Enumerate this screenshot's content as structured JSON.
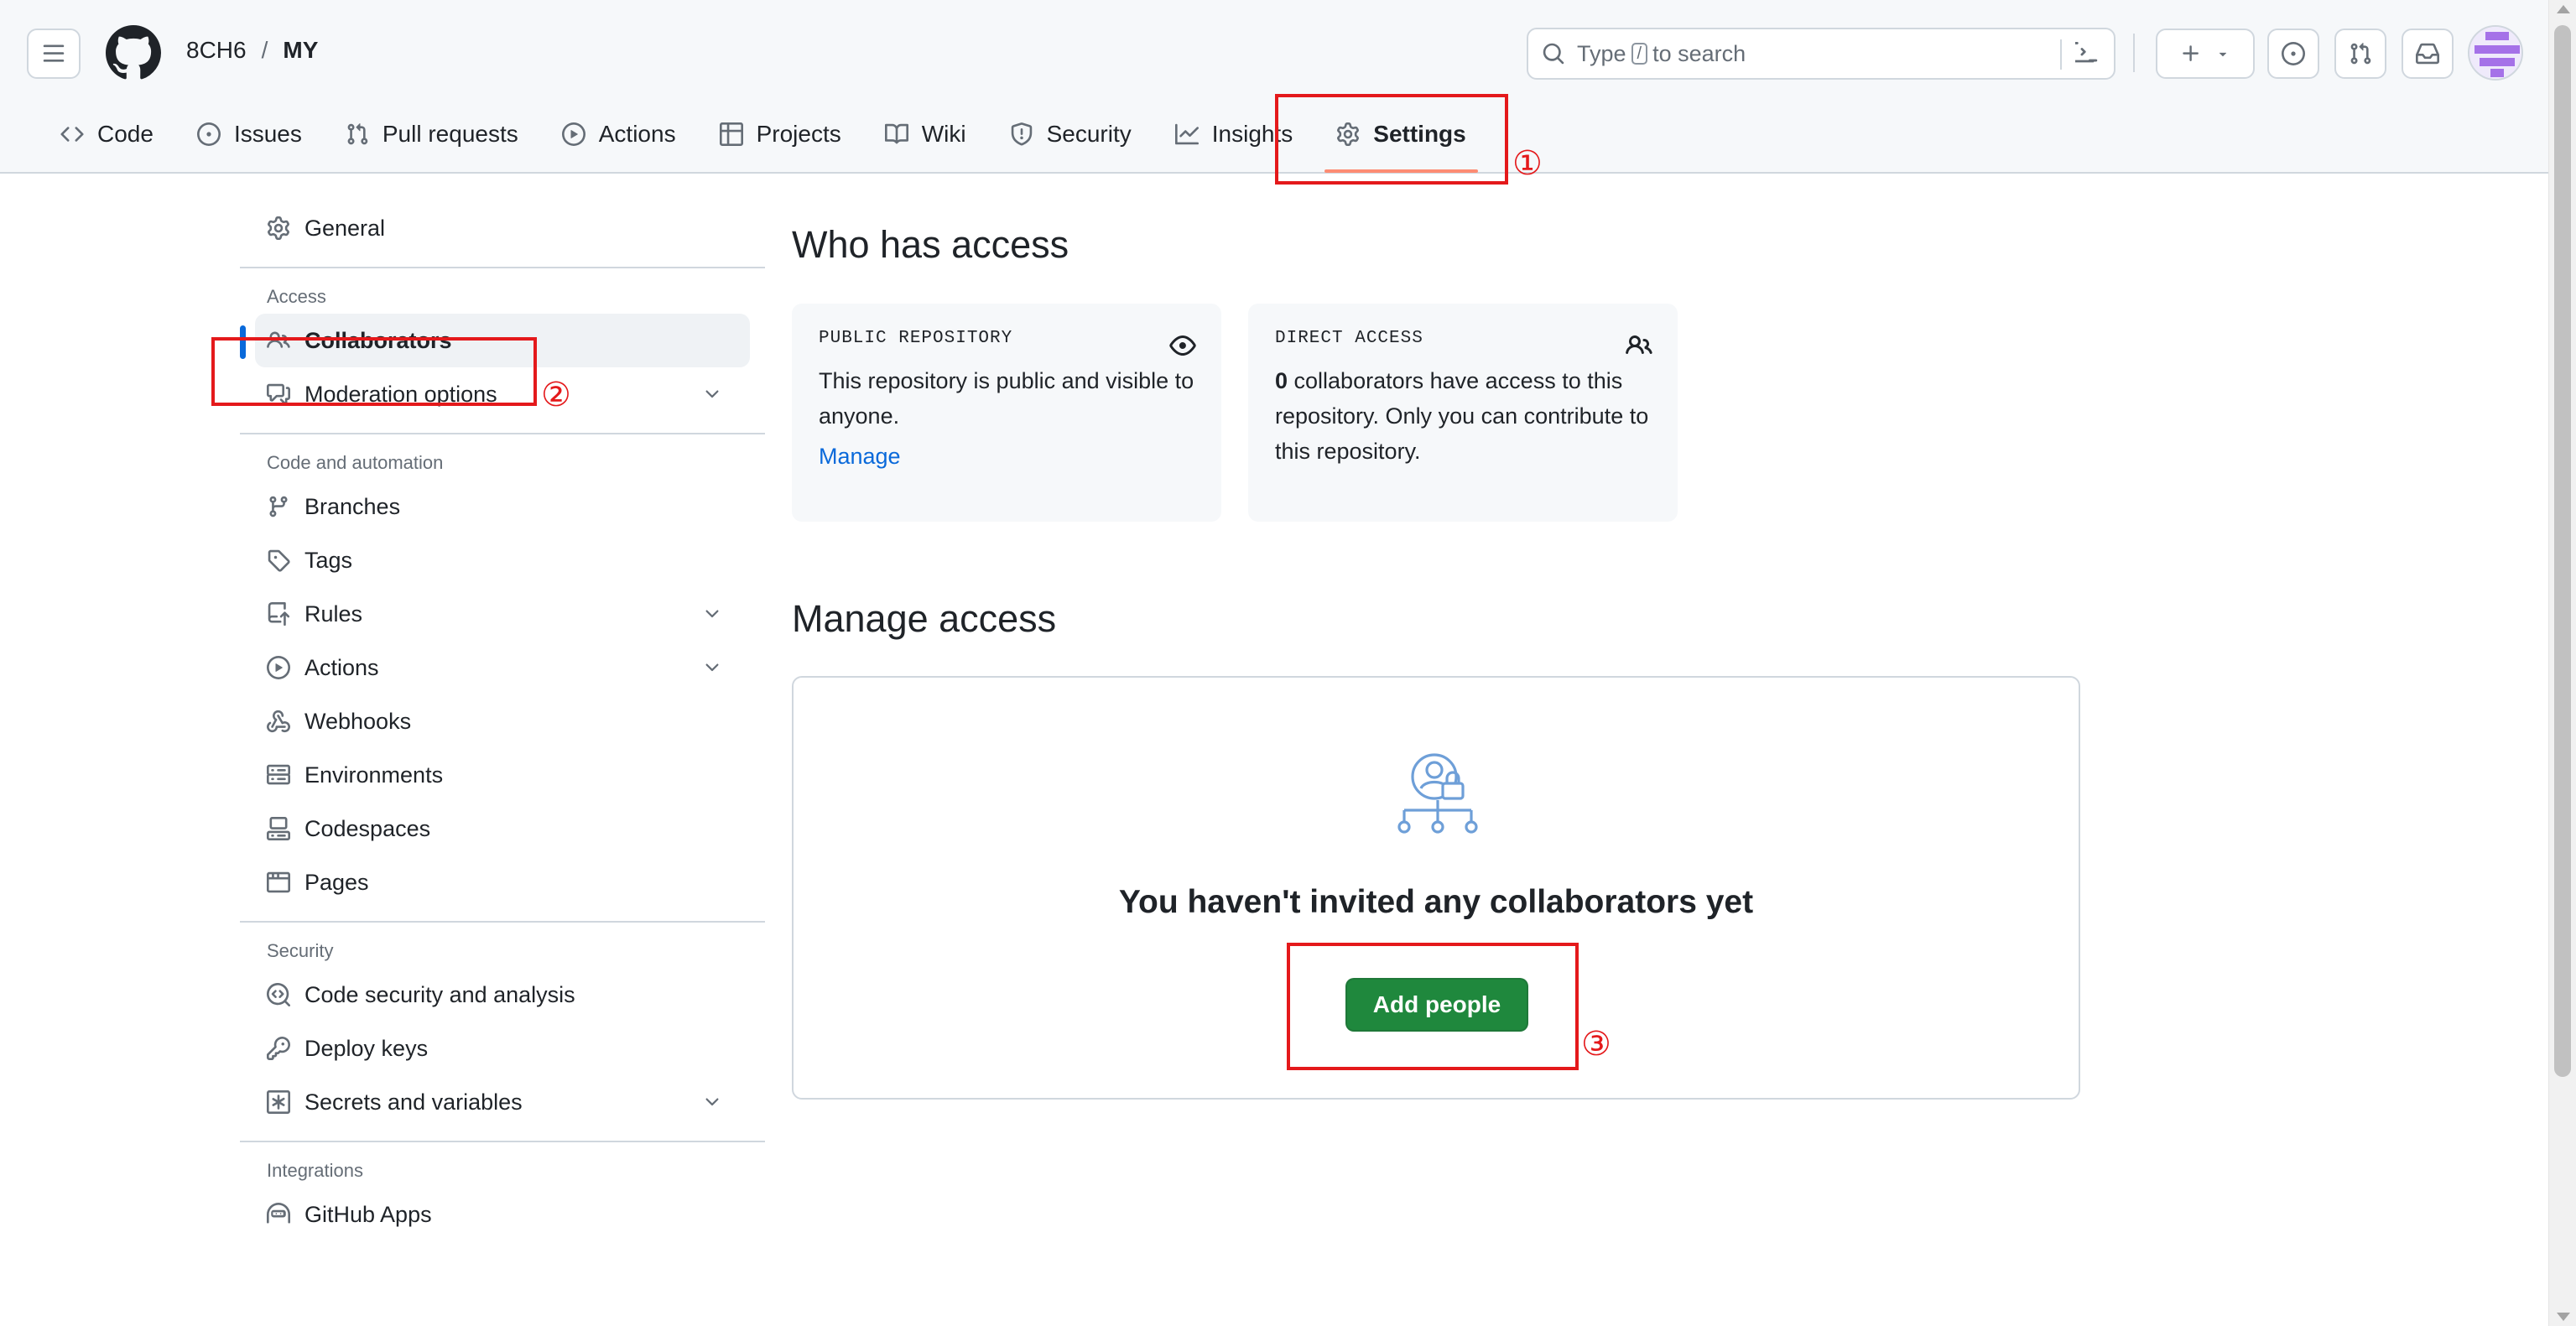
{
  "breadcrumb": {
    "owner": "8CH6",
    "separator": "/",
    "repo": "MY"
  },
  "search": {
    "placeholder_before": "Type",
    "key": "/",
    "placeholder_after": "to search"
  },
  "repo_nav": {
    "code": "Code",
    "issues": "Issues",
    "pull_requests": "Pull requests",
    "actions": "Actions",
    "projects": "Projects",
    "wiki": "Wiki",
    "security": "Security",
    "insights": "Insights",
    "settings": "Settings"
  },
  "annotations": {
    "one": "①",
    "two": "②",
    "three": "③"
  },
  "sidebar": {
    "general": "General",
    "access_heading": "Access",
    "collaborators": "Collaborators",
    "moderation": "Moderation options",
    "code_automation_heading": "Code and automation",
    "branches": "Branches",
    "tags": "Tags",
    "rules": "Rules",
    "actions": "Actions",
    "webhooks": "Webhooks",
    "environments": "Environments",
    "codespaces": "Codespaces",
    "pages": "Pages",
    "security_heading": "Security",
    "code_security": "Code security and analysis",
    "deploy_keys": "Deploy keys",
    "secrets": "Secrets and variables",
    "integrations_heading": "Integrations",
    "github_apps": "GitHub Apps"
  },
  "main": {
    "who_has_access_title": "Who has access",
    "public_card": {
      "label": "PUBLIC REPOSITORY",
      "text": "This repository is public and visible to anyone.",
      "link": "Manage"
    },
    "direct_card": {
      "label": "DIRECT ACCESS",
      "count": "0",
      "text": " collaborators have access to this repository. Only you can contribute to this repository."
    },
    "manage_access_title": "Manage access",
    "empty_title": "You haven't invited any collaborators yet",
    "add_people_button": "Add people"
  },
  "colors": {
    "accent_blue": "#0969da",
    "primary_green": "#1f883d",
    "annotation_red": "#e4191b",
    "active_tab_underline": "#fd8c73"
  }
}
